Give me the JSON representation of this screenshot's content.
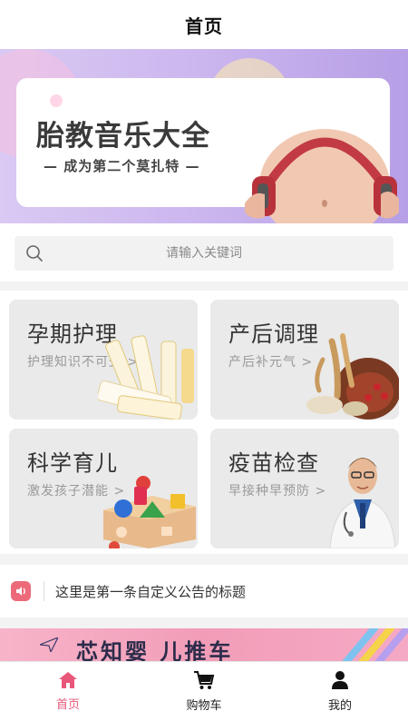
{
  "header": {
    "title": "首页"
  },
  "banner": {
    "headline": "胎教音乐大全",
    "subline": "— 成为第二个莫扎特 —",
    "active_slide": 1,
    "slide_count": 1
  },
  "search": {
    "placeholder": "请输入关键词"
  },
  "categories": [
    {
      "title": "孕期护理",
      "subtitle": "护理知识不可少 >",
      "icon": "skincare-bottles-icon"
    },
    {
      "title": "产后调理",
      "subtitle": "产后补元气 >",
      "icon": "ginseng-herbs-icon"
    },
    {
      "title": "科学育儿",
      "subtitle": "激发孩子潜能 >",
      "icon": "shape-sorter-toy-icon"
    },
    {
      "title": "疫苗检查",
      "subtitle": "早接种早预防 >",
      "icon": "doctor-icon"
    }
  ],
  "notice": {
    "text": "这里是第一条自定义公告的标题",
    "icon": "speaker-icon"
  },
  "promo": {
    "text": "芯知婴 儿推车"
  },
  "tabbar": {
    "items": [
      {
        "label": "首页",
        "icon": "home-icon",
        "active": true
      },
      {
        "label": "购物车",
        "icon": "cart-icon",
        "active": false
      },
      {
        "label": "我的",
        "icon": "user-icon",
        "active": false
      }
    ]
  },
  "colors": {
    "accent": "#e8577a",
    "banner_bg": "#cdb8ef",
    "notice_icon": "#ec6a7a"
  }
}
